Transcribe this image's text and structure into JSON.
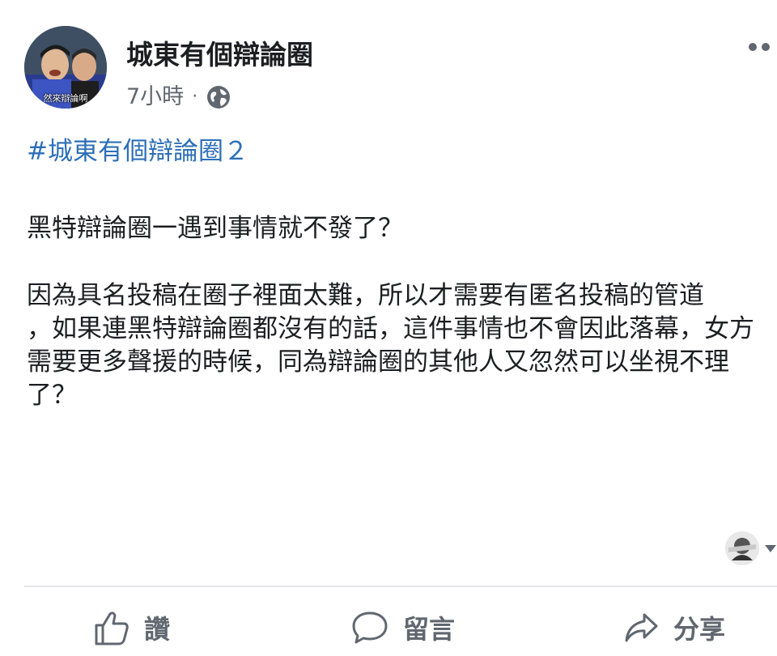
{
  "post": {
    "page_name": "城東有個辯論圈",
    "timestamp": "7小時",
    "separator": "·",
    "audience_icon": "globe-icon",
    "avatar_caption": "然來辯論啊",
    "hashtag": "#城東有個辯論圈２",
    "paragraphs": [
      "黑特辯論圈一遇到事情就不發了？",
      "因為具名投稿在圈子裡面太難，所以才需要有匿名投稿的管道",
      "，如果連黑特辯論圈都沒有的話，這件事情也不會因此落幕，女方需要更多聲援的時候，同為辯論圈的其他人又忽然可以坐視不理了？"
    ]
  },
  "actions": {
    "like": {
      "label": "讚",
      "icon": "thumbs-up-icon"
    },
    "comment": {
      "label": "留言",
      "icon": "comment-bubble-icon"
    },
    "share": {
      "label": "分享",
      "icon": "share-arrow-icon"
    }
  },
  "colors": {
    "hashtag": "#2d6fb7",
    "text": "#1c1e21",
    "secondary": "#606770",
    "divider": "#e4e6eb"
  }
}
